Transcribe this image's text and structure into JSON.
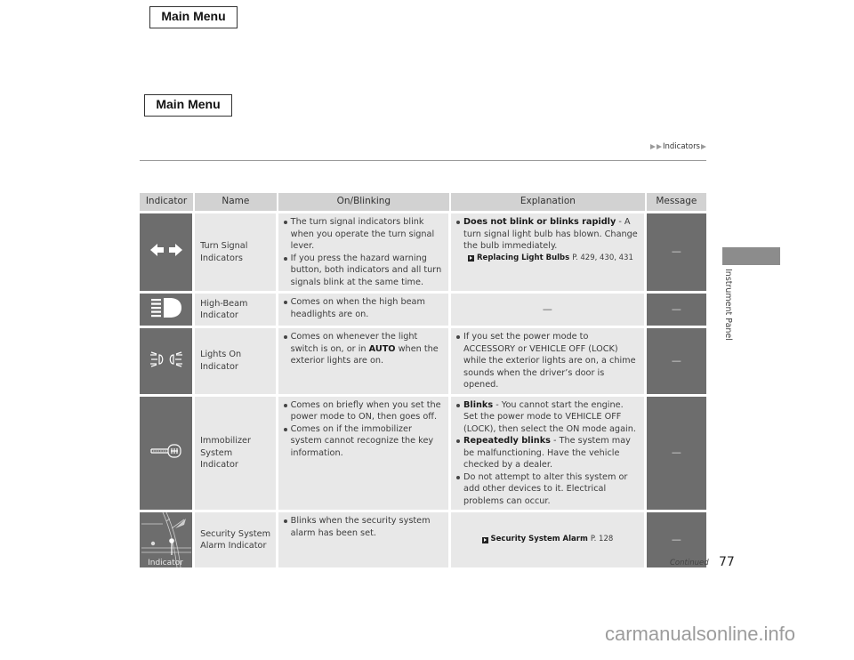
{
  "nav": {
    "main_menu_top": "Main Menu",
    "main_menu_second": "Main Menu"
  },
  "breadcrumb": {
    "section": "Indicators"
  },
  "side_tab": {
    "label": "Instrument Panel"
  },
  "table": {
    "headers": [
      "Indicator",
      "Name",
      "On/Blinking",
      "Explanation",
      "Message"
    ],
    "rows": [
      {
        "icon": "turn-signal-arrows-icon",
        "name": "Turn Signal Indicators",
        "on_blinking": [
          "The turn signal indicators blink when you operate the turn signal lever.",
          "If you press the hazard warning button, both indicators and all turn signals blink at the same time."
        ],
        "explanation": {
          "items": [
            {
              "bold": "Does not blink or blinks rapidly",
              "text": " - A turn signal light bulb has blown. Change the bulb immediately."
            }
          ],
          "ref_title": "Replacing Light Bulbs",
          "ref_pages": "P. 429, 430, 431"
        },
        "message": "—"
      },
      {
        "icon": "high-beam-icon",
        "name": "High-Beam Indicator",
        "on_blinking": [
          "Comes on when the high beam headlights are on."
        ],
        "explanation": {
          "text": "—"
        },
        "message": "—"
      },
      {
        "icon": "lights-on-icon",
        "name": "Lights On Indicator",
        "on_blinking_parts": {
          "before": "Comes on whenever the light switch is on, or in ",
          "bold": "AUTO",
          "after": " when the exterior lights are on."
        },
        "explanation": {
          "items": [
            {
              "text": "If you set the power mode to ACCESSORY or VEHICLE OFF (LOCK) while the exterior lights are on, a chime sounds when the driver’s door is opened."
            }
          ]
        },
        "message": "—"
      },
      {
        "icon": "immobilizer-key-icon",
        "name": "Immobilizer System Indicator",
        "on_blinking": [
          "Comes on briefly when you set the power mode to ON, then goes off.",
          "Comes on if the immobilizer system cannot recognize the key information."
        ],
        "explanation": {
          "items": [
            {
              "bold": "Blinks",
              "text": " - You cannot start the engine. Set the power mode to VEHICLE OFF (LOCK), then select the ON mode again."
            },
            {
              "bold": "Repeatedly blinks",
              "text": " - The system may be malfunctioning. Have the vehicle checked by a dealer."
            },
            {
              "text": "Do not attempt to alter this system or add other devices to it. Electrical problems can occur."
            }
          ]
        },
        "message": "—"
      },
      {
        "icon": "security-alarm-indicator-icon",
        "icon_caption": "Indicator",
        "name": "Security System Alarm Indicator",
        "on_blinking": [
          "Blinks when the security system alarm has been set."
        ],
        "explanation": {
          "ref_title": "Security System Alarm",
          "ref_pages": "P. 128"
        },
        "message": "—"
      }
    ]
  },
  "footer": {
    "continued": "Continued",
    "page_number": "77",
    "watermark": "carmanualsonline.info"
  }
}
